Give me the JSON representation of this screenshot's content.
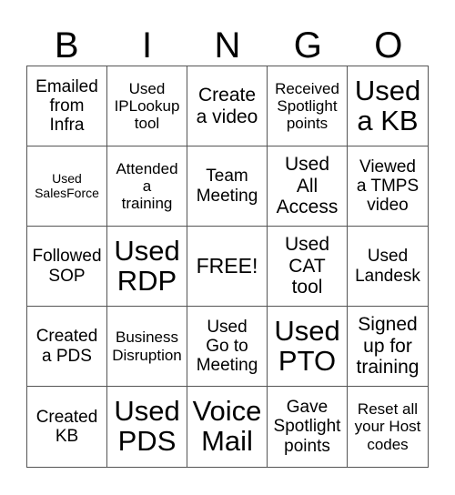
{
  "header": [
    "B",
    "I",
    "N",
    "G",
    "O"
  ],
  "cells": [
    "Emailed\nfrom\nInfra",
    "Used\nIPLookup\ntool",
    "Create\na video",
    "Received\nSpotlight\npoints",
    "Used\na KB",
    "Used\nSalesForce",
    "Attended\na\ntraining",
    "Team\nMeeting",
    "Used\nAll\nAccess",
    "Viewed\na TMPS\nvideo",
    "Followed\nSOP",
    "Used\nRDP",
    "FREE!",
    "Used\nCAT\ntool",
    "Used\nLandesk",
    "Created\na PDS",
    "Business\nDisruption",
    "Used\nGo to\nMeeting",
    "Used\nPTO",
    "Signed\nup for\ntraining",
    "Created\nKB",
    "Used\nPDS",
    "Voice\nMail",
    "Gave\nSpotlight\npoints",
    "Reset all\nyour Host\ncodes"
  ]
}
